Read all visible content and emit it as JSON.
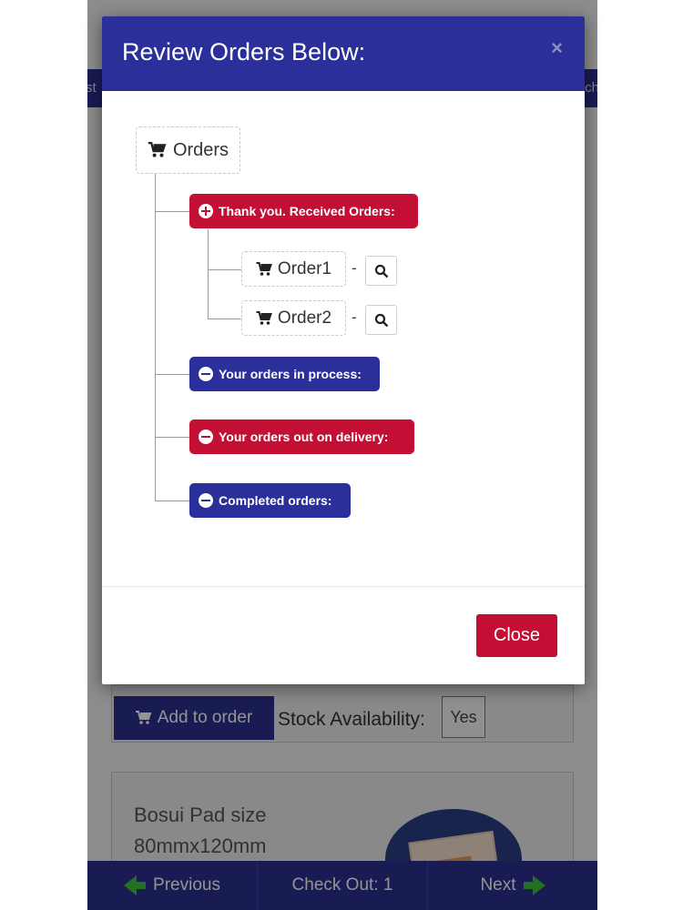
{
  "background": {
    "topbar_left_fragment": "st",
    "topbar_right_fragment": "ch",
    "add_to_order_label": "Add to order",
    "stock_label": "Stock Availability:",
    "stock_value": "Yes",
    "product_name": "Bosui Pad size 80mmx120mm",
    "bottom_nav": {
      "previous": "Previous",
      "checkout": "Check Out: 1",
      "next": "Next"
    }
  },
  "modal": {
    "title": "Review Orders Below:",
    "close_x": "×",
    "close_button": "Close",
    "tree": {
      "root_label": "Orders",
      "groups": [
        {
          "label": "Thank you. Received Orders:",
          "color": "#c40f35",
          "toggle": "plus"
        },
        {
          "label": "Your orders in process:",
          "color": "#2b2f9a",
          "toggle": "minus"
        },
        {
          "label": "Your orders out on delivery:",
          "color": "#c40f35",
          "toggle": "minus"
        },
        {
          "label": "Completed orders:",
          "color": "#2b2f9a",
          "toggle": "minus"
        }
      ],
      "orders": [
        {
          "label": "Order1",
          "separator": "-"
        },
        {
          "label": "Order2",
          "separator": "-"
        }
      ]
    }
  },
  "icons": {
    "cart": "shopping-cart-icon",
    "search": "search-icon",
    "plus": "plus-circle-icon",
    "minus": "minus-circle-icon",
    "arrow_left": "arrow-left-icon",
    "arrow_right": "arrow-right-icon"
  }
}
